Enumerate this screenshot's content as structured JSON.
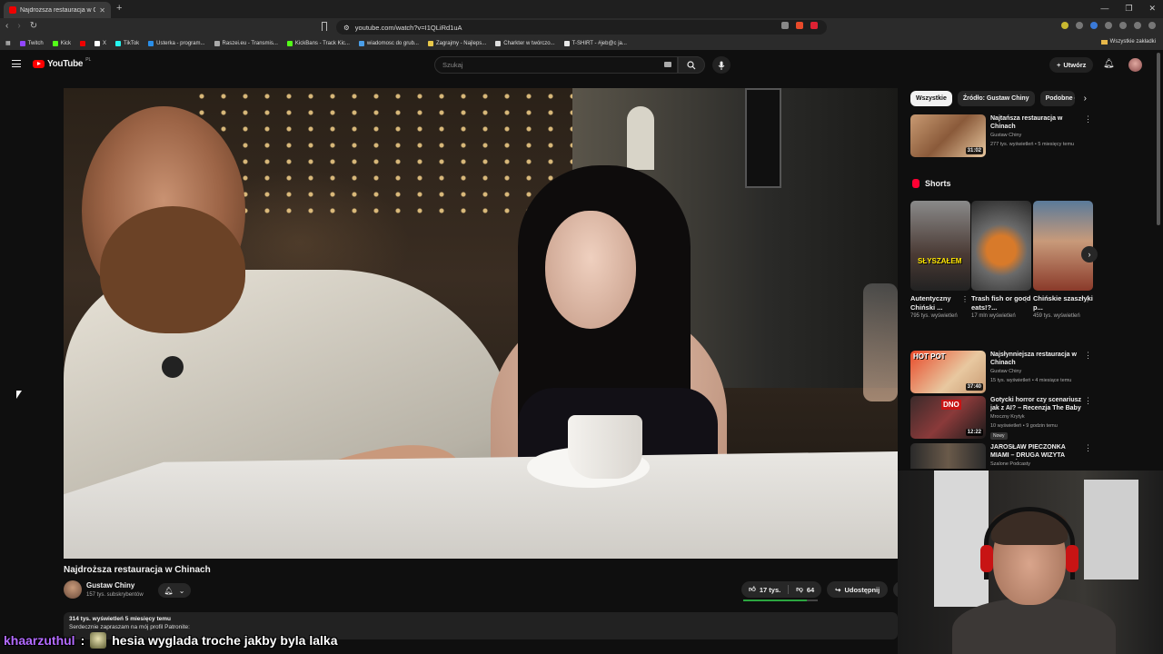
{
  "browser": {
    "tab_title": "Najdroższa restauracja w Chi",
    "url": "youtube.com/watch?v=I1QLiRd1uA",
    "bookmarks": [
      "Twitch",
      "Kick",
      "X",
      "TikTok",
      "Usterka - program...",
      "Raszei.eu - Transmis...",
      "KickBans - Track Kic...",
      "wiadomosc do grub...",
      "Zagrajmy - Najleps...",
      "Charkter w twórczo...",
      "T-SHIRT - #jeb@c ja..."
    ],
    "bookmarks_all": "Wszystkie zakładki"
  },
  "yt": {
    "logo": "YouTube",
    "region": "PL",
    "search_placeholder": "Szukaj",
    "create_label": "Utwórz"
  },
  "video": {
    "title": "Najdroższa restauracja w Chinach",
    "channel": "Gustaw Chiny",
    "subscribers": "157 tys. subskrybentów",
    "likes": "17 tys.",
    "dislikes": "64",
    "like_ratio": 0.85,
    "share_label": "Udostępnij",
    "views_date": "314 tys. wyświetleń  5 miesięcy temu",
    "description": "Serdecznie zapraszam na mój profil Patronite:"
  },
  "sidebar": {
    "chips": [
      "Wszystkie",
      "Źródło: Gustaw Chiny",
      "Podobne do"
    ],
    "shorts_title": "Shorts",
    "rec_top": {
      "title": "Najtańsza restauracja w Chinach",
      "channel": "Gustaw Chiny",
      "meta": "277 tys. wyświetleń • 5 miesięcy temu",
      "duration": "31:02"
    },
    "shorts": [
      {
        "title": "Autentyczny Chiński ...",
        "views": "795 tys. wyświetleń",
        "overlay": "SŁYSZAŁEM"
      },
      {
        "title": "Trash fish or good eats!?...",
        "views": "17 mln wyświetleń",
        "overlay": ""
      },
      {
        "title": "Chińskie szaszłyki p...",
        "views": "459 tys. wyświetleń",
        "overlay": ""
      }
    ],
    "recs": [
      {
        "title": "Najsłynniejsza restauracja w Chinach",
        "channel": "Gustaw Chiny",
        "meta": "15 tys. wyświetleń • 4 miesiące temu",
        "duration": "37:40",
        "badge": "",
        "thumb_text": "HOT POT"
      },
      {
        "title": "Gotycki horror czy scenariusz jak z AI? – Recenzja The Baby ...",
        "channel": "Mroczny Krytyk",
        "meta": "10 wyświetleń • 9 godzin temu",
        "duration": "12:22",
        "badge": "Nowy",
        "thumb_text": "DNO"
      },
      {
        "title": "JAROSŁAW PIECZONKA MIAMI – DRUGA WIZYTA INTRUZÓW ...",
        "channel": "Szalone Podcasty",
        "meta": "",
        "duration": "",
        "badge": "",
        "thumb_text": ""
      }
    ]
  },
  "chat": {
    "user": "khaarzuthul",
    "separator": ":",
    "message": "hesia wyglada troche jakby byla lalka"
  }
}
